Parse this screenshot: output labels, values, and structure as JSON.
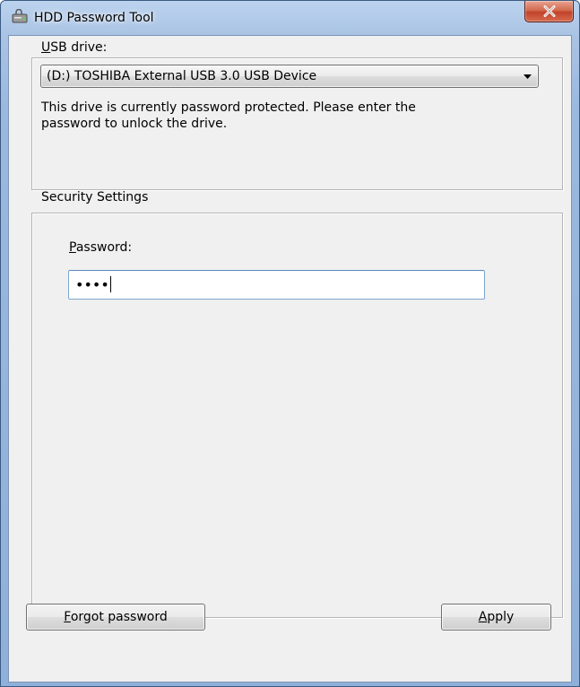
{
  "window": {
    "title": "HDD Password Tool",
    "colors": {
      "frame": "#9bb8de",
      "client": "#f0f0f0",
      "close_button": "#c1432a"
    }
  },
  "usb_group": {
    "label_first": "U",
    "label_rest": "SB drive:",
    "selected_drive": "(D:) TOSHIBA External USB 3.0 USB Device",
    "status_text": "This drive is currently password protected.  Please enter the\npassword to unlock the drive."
  },
  "security_group": {
    "title": "Security Settings",
    "password_label_first": "P",
    "password_label_rest": "assword:",
    "password_masked": "••••"
  },
  "buttons": {
    "forgot_first": "F",
    "forgot_rest": "orgot password",
    "apply_first": "A",
    "apply_rest": "pply"
  }
}
